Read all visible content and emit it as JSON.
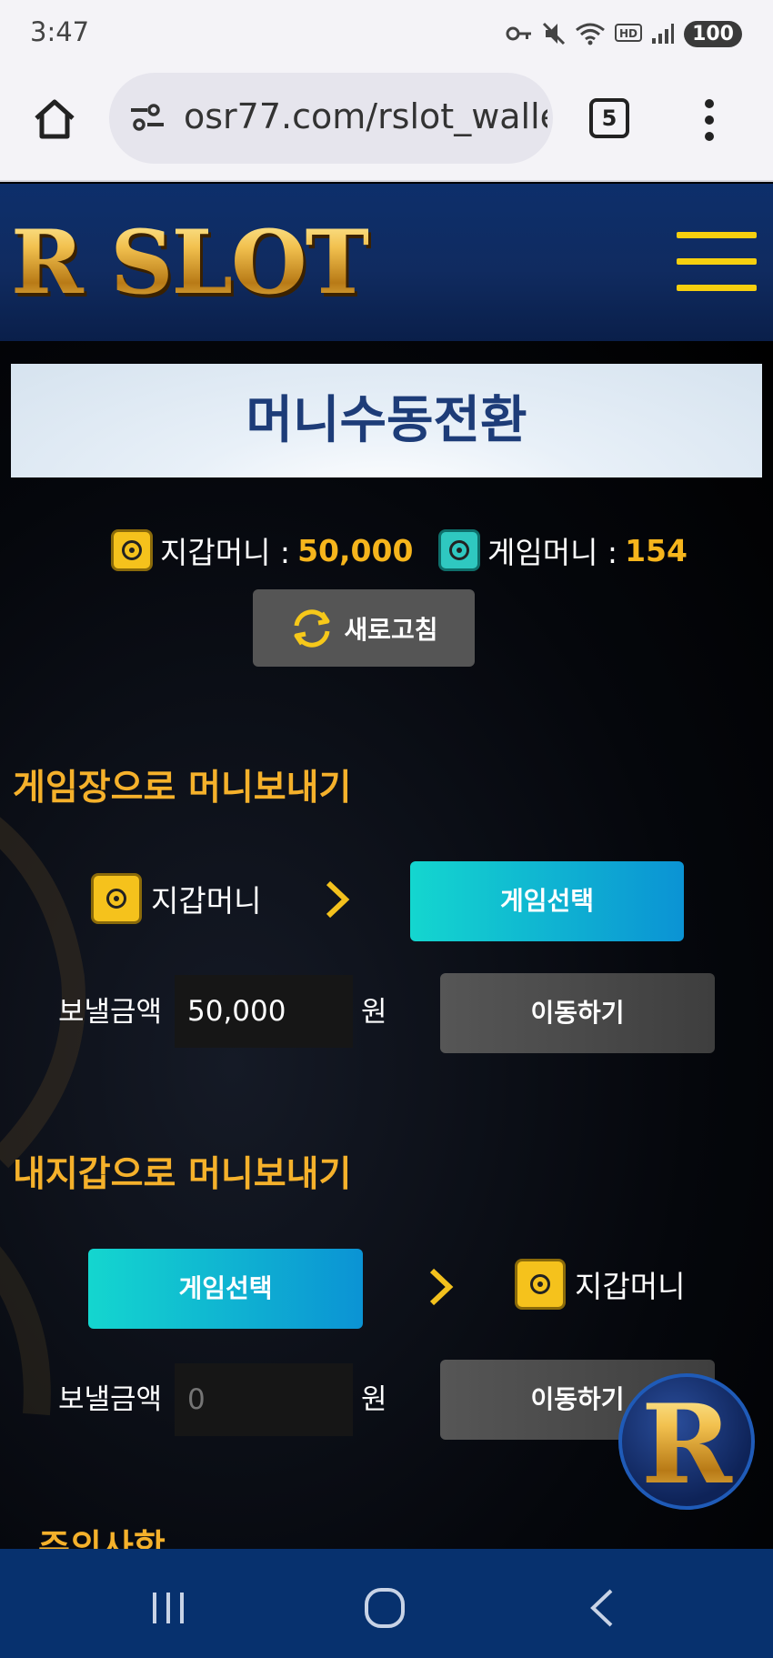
{
  "status_bar": {
    "time": "3:47",
    "battery": "100"
  },
  "browser": {
    "url": "osr77.com/rslot_walle",
    "tab_count": "5"
  },
  "site": {
    "logo": "R SLOT",
    "float_logo": "R"
  },
  "page": {
    "title": "머니수동전환",
    "wallet_label": "지갑머니 :",
    "wallet_value": "50,000",
    "game_label": "게임머니 :",
    "game_value": "154",
    "refresh_label": "새로고침"
  },
  "to_game": {
    "title": "게임장으로 머니보내기",
    "from_label": "지갑머니",
    "game_select": "게임선택",
    "amount_label": "보낼금액",
    "amount_value": "50,000",
    "unit": "원",
    "move_label": "이동하기"
  },
  "to_wallet": {
    "title": "내지갑으로 머니보내기",
    "game_select": "게임선택",
    "to_label": "지갑머니",
    "amount_label": "보낼금액",
    "amount_placeholder": "0",
    "unit": "원",
    "move_label": "이동하기"
  },
  "notice": {
    "title": "주의사항"
  },
  "colors": {
    "accent_gold": "#f5b12b",
    "header_blue": "#0d2f6b",
    "game_button_start": "#14d6cf",
    "game_button_end": "#0b93d4",
    "title_text": "#1d3c78"
  },
  "icons": [
    "key-icon",
    "mute-icon",
    "wifi-icon",
    "hd-icon",
    "signal-icon",
    "home-icon",
    "site-settings-icon",
    "more-icon",
    "menu-icon",
    "safe-icon",
    "refresh-icon",
    "chevron-right-icon",
    "recents-icon",
    "home-nav-icon",
    "back-icon"
  ]
}
